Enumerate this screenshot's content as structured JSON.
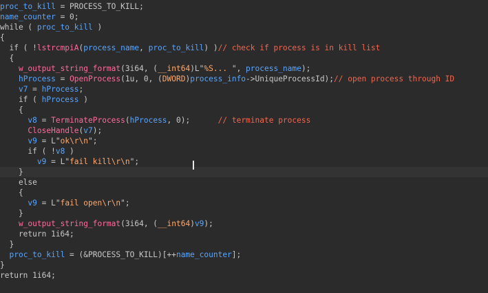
{
  "colors": {
    "background": "#2b2b2b",
    "current_line": "#333333",
    "default": "#c9c9c9",
    "variable": "#58a6ff",
    "function": "#ff6b9d",
    "string": "#ffab70",
    "comment": "#f4664f",
    "caret": "#e8e8e8"
  },
  "editor": {
    "current_line_index": 16,
    "lines": [
      [
        [
          "v",
          "proc_to_kill"
        ],
        [
          "d",
          " = PROCESS_TO_KILL;"
        ]
      ],
      [
        [
          "v",
          "name_counter"
        ],
        [
          "d",
          " = 0;"
        ]
      ],
      [
        [
          "d",
          "while ( "
        ],
        [
          "v",
          "proc_to_kill"
        ],
        [
          "d",
          " )"
        ]
      ],
      [
        [
          "d",
          "{"
        ]
      ],
      [
        [
          "d",
          "  if ( !"
        ],
        [
          "f",
          "lstrcmpiA"
        ],
        [
          "d",
          "("
        ],
        [
          "v",
          "process_name"
        ],
        [
          "d",
          ", "
        ],
        [
          "v",
          "proc_to_kill"
        ],
        [
          "d",
          ") )"
        ],
        [
          "c",
          "// check if process is in kill list"
        ]
      ],
      [
        [
          "d",
          "  {"
        ]
      ],
      [
        [
          "d",
          "    "
        ],
        [
          "f",
          "w_output_string_format"
        ],
        [
          "d",
          "(3i64, ("
        ],
        [
          "s",
          "__int64"
        ],
        [
          "d",
          ")L\""
        ],
        [
          "s",
          "%S... "
        ],
        [
          "d",
          "\", "
        ],
        [
          "v",
          "process_name"
        ],
        [
          "d",
          ");"
        ]
      ],
      [
        [
          "d",
          "    "
        ],
        [
          "v",
          "hProcess"
        ],
        [
          "d",
          " = "
        ],
        [
          "f",
          "OpenProcess"
        ],
        [
          "d",
          "(1u, 0, ("
        ],
        [
          "s",
          "DWORD"
        ],
        [
          "d",
          ")"
        ],
        [
          "v",
          "process_info"
        ],
        [
          "d",
          "->UniqueProcessId);"
        ],
        [
          "c",
          "// open process through ID"
        ]
      ],
      [
        [
          "d",
          "    "
        ],
        [
          "v",
          "v7"
        ],
        [
          "d",
          " = "
        ],
        [
          "v",
          "hProcess"
        ],
        [
          "d",
          ";"
        ]
      ],
      [
        [
          "d",
          "    if ( "
        ],
        [
          "v",
          "hProcess"
        ],
        [
          "d",
          " )"
        ]
      ],
      [
        [
          "d",
          "    {"
        ]
      ],
      [
        [
          "d",
          "      "
        ],
        [
          "v",
          "v8"
        ],
        [
          "d",
          " = "
        ],
        [
          "f",
          "TerminateProcess"
        ],
        [
          "d",
          "("
        ],
        [
          "v",
          "hProcess"
        ],
        [
          "d",
          ", 0);      "
        ],
        [
          "c",
          "// terminate process"
        ]
      ],
      [
        [
          "d",
          "      "
        ],
        [
          "f",
          "CloseHandle"
        ],
        [
          "d",
          "("
        ],
        [
          "v",
          "v7"
        ],
        [
          "d",
          ");"
        ]
      ],
      [
        [
          "d",
          "      "
        ],
        [
          "v",
          "v9"
        ],
        [
          "d",
          " = L\""
        ],
        [
          "s",
          "ok\\r\\n"
        ],
        [
          "d",
          "\";"
        ]
      ],
      [
        [
          "d",
          "      if ( !"
        ],
        [
          "v",
          "v8"
        ],
        [
          "d",
          " )"
        ]
      ],
      [
        [
          "d",
          "        "
        ],
        [
          "v",
          "v9"
        ],
        [
          "d",
          " = L\""
        ],
        [
          "s",
          "fail kill\\r\\n"
        ],
        [
          "d",
          "\";"
        ]
      ],
      [
        [
          "d",
          "    }"
        ]
      ],
      [
        [
          "d",
          "    else"
        ]
      ],
      [
        [
          "d",
          "    {"
        ]
      ],
      [
        [
          "d",
          "      "
        ],
        [
          "v",
          "v9"
        ],
        [
          "d",
          " = L\""
        ],
        [
          "s",
          "fail open\\r\\n"
        ],
        [
          "d",
          "\";"
        ]
      ],
      [
        [
          "d",
          "    }"
        ]
      ],
      [
        [
          "d",
          "    "
        ],
        [
          "f",
          "w_output_string_format"
        ],
        [
          "d",
          "(3i64, ("
        ],
        [
          "s",
          "__int64"
        ],
        [
          "d",
          ")"
        ],
        [
          "v",
          "v9"
        ],
        [
          "d",
          ");"
        ]
      ],
      [
        [
          "d",
          "    return 1i64;"
        ]
      ],
      [
        [
          "d",
          "  }"
        ]
      ],
      [
        [
          "d",
          "  "
        ],
        [
          "v",
          "proc_to_kill"
        ],
        [
          "d",
          " = (&PROCESS_TO_KILL)[++"
        ],
        [
          "v",
          "name_counter"
        ],
        [
          "d",
          "];"
        ]
      ],
      [
        [
          "d",
          "}"
        ]
      ],
      [
        [
          "d",
          "return 1i64;"
        ]
      ]
    ]
  }
}
